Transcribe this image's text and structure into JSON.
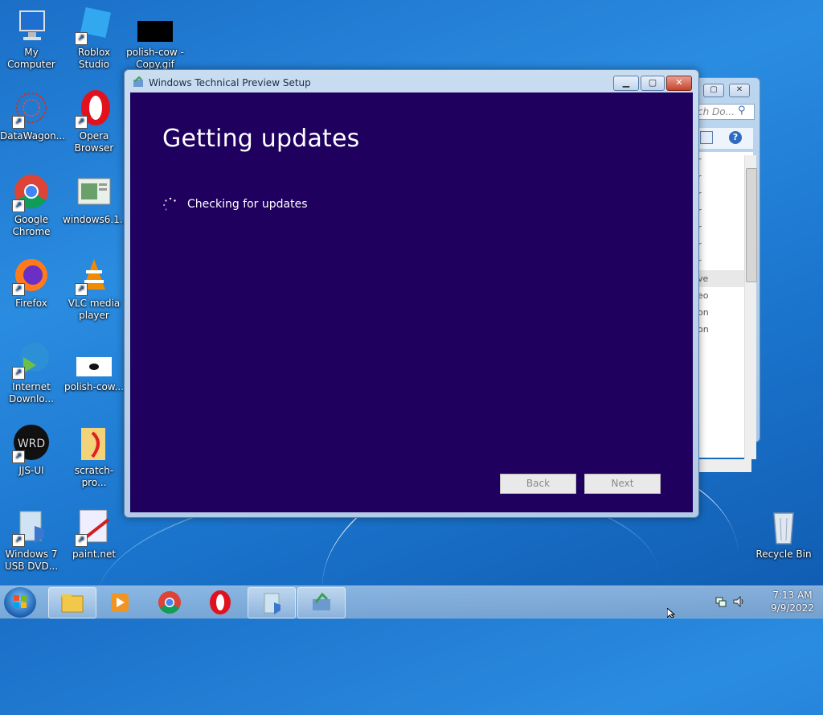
{
  "desktop": {
    "icons": [
      {
        "name": "my-computer",
        "label": "My Computer"
      },
      {
        "name": "roblox-studio",
        "label": "Roblox Studio"
      },
      {
        "name": "polish-cow-copy",
        "label": "polish-cow -\nCopy.gif"
      },
      {
        "name": "datawagon",
        "label": "DataWagon..."
      },
      {
        "name": "opera",
        "label": "Opera\nBrowser"
      },
      {
        "name": "google-chrome",
        "label": "Google\nChrome"
      },
      {
        "name": "windows61",
        "label": "windows6.1..."
      },
      {
        "name": "firefox",
        "label": "Firefox"
      },
      {
        "name": "vlc",
        "label": "VLC media\nplayer"
      },
      {
        "name": "internet-download",
        "label": "Internet\nDownlo..."
      },
      {
        "name": "polish-cow",
        "label": "polish-cow..."
      },
      {
        "name": "jjs-ui",
        "label": "JJS-UI"
      },
      {
        "name": "scratch-pro",
        "label": "scratch-pro..."
      },
      {
        "name": "windows7-usb",
        "label": "Windows 7\nUSB DVD..."
      },
      {
        "name": "paint-net",
        "label": "paint.net"
      },
      {
        "name": "recycle-bin",
        "label": "Recycle Bin"
      }
    ]
  },
  "background_window": {
    "search_placeholder": "ch Do...",
    "rows": [
      "r",
      "r",
      "r",
      "r",
      "r",
      "r",
      "r",
      "ve",
      "eo",
      "on",
      "on"
    ]
  },
  "setup_window": {
    "title": "Windows Technical Preview Setup",
    "heading": "Getting updates",
    "status": "Checking for updates",
    "back_label": "Back",
    "next_label": "Next"
  },
  "taskbar": {
    "time": "7:13 AM",
    "date": "9/9/2022"
  }
}
